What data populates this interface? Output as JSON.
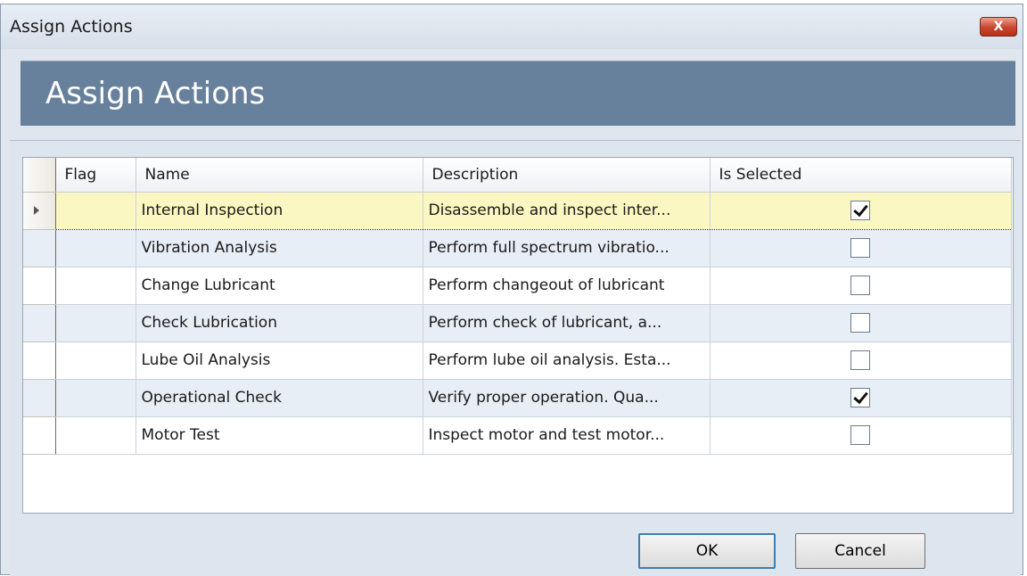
{
  "window": {
    "title": "Assign Actions",
    "close_label": "X"
  },
  "header": {
    "title": "Assign Actions"
  },
  "grid": {
    "columns": [
      "",
      "Flag",
      "Name",
      "Description",
      "Is Selected"
    ],
    "rows": [
      {
        "flag": "",
        "name": "Internal Inspection",
        "description": "Disassemble and inspect inter...",
        "selected": true
      },
      {
        "flag": "",
        "name": "Vibration Analysis",
        "description": "Perform full spectrum vibratio...",
        "selected": false
      },
      {
        "flag": "",
        "name": "Change Lubricant",
        "description": "Perform changeout of lubricant",
        "selected": false
      },
      {
        "flag": "",
        "name": "Check Lubrication",
        "description": "Perform check of lubricant, a...",
        "selected": false
      },
      {
        "flag": "",
        "name": "Lube Oil Analysis",
        "description": "Perform lube oil analysis. Esta...",
        "selected": false
      },
      {
        "flag": "",
        "name": "Operational Check",
        "description": "Verify proper operation.  Qua...",
        "selected": true
      },
      {
        "flag": "",
        "name": "Motor Test",
        "description": "Inspect motor and test motor...",
        "selected": false
      }
    ]
  },
  "buttons": {
    "ok": "OK",
    "cancel": "Cancel"
  }
}
